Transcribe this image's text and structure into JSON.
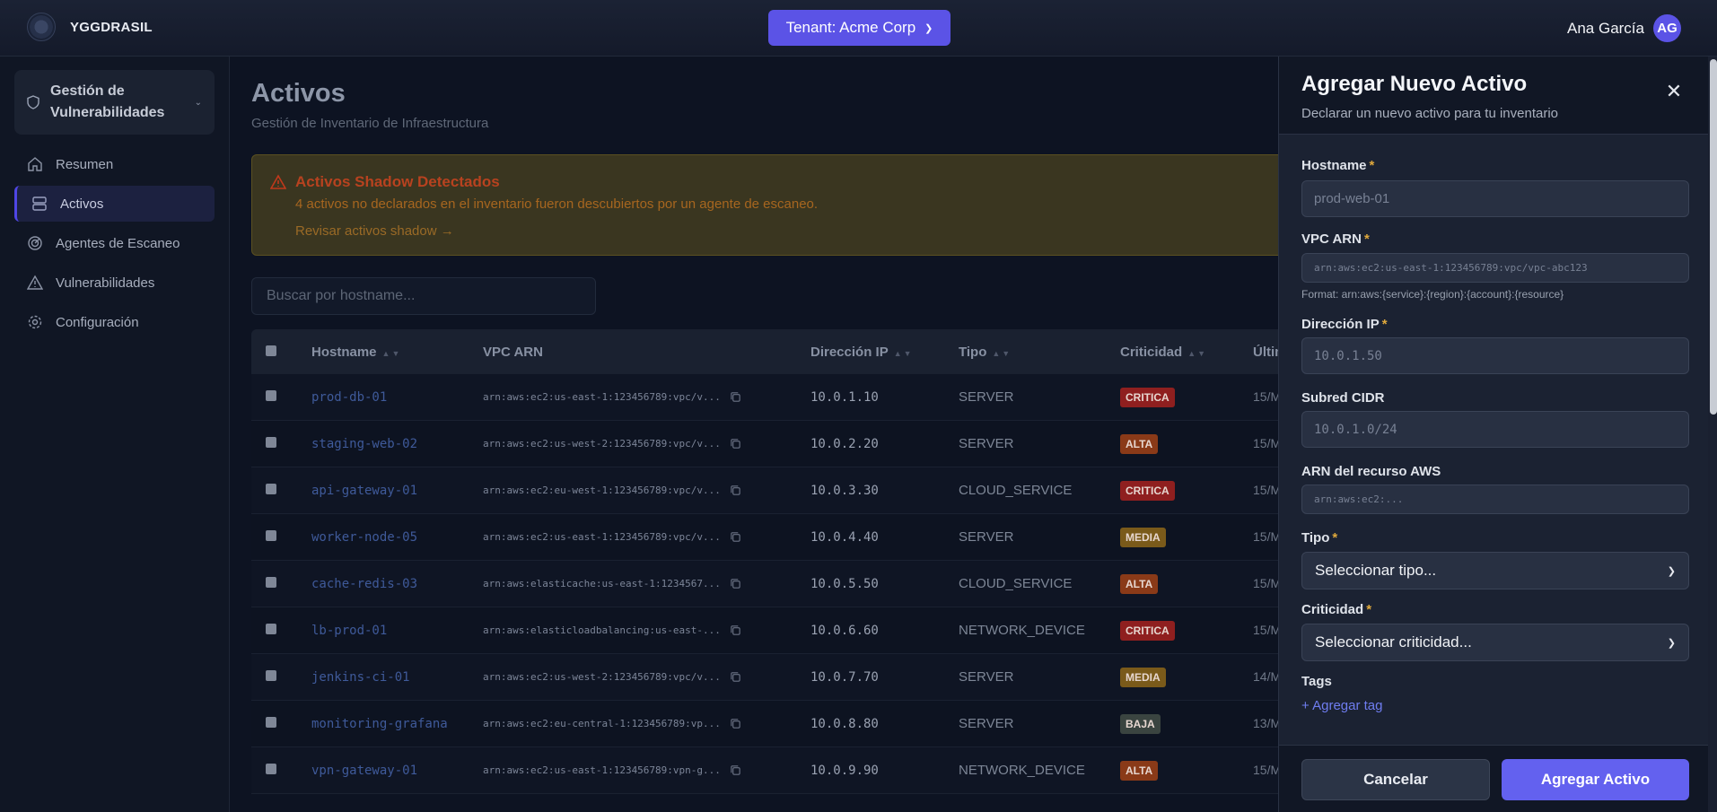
{
  "app": {
    "name": "YGGDRASIL"
  },
  "tenant": {
    "label": "Tenant: Acme Corp"
  },
  "user": {
    "name": "Ana García",
    "initials": "AG"
  },
  "sidebar": {
    "module": "Gestión de Vulnerabilidades",
    "items": [
      {
        "label": "Resumen",
        "icon": "home-icon"
      },
      {
        "label": "Activos",
        "icon": "server-icon",
        "active": true
      },
      {
        "label": "Agentes de Escaneo",
        "icon": "radar-icon"
      },
      {
        "label": "Vulnerabilidades",
        "icon": "warning-icon"
      },
      {
        "label": "Configuración",
        "icon": "gear-icon"
      }
    ]
  },
  "page": {
    "title": "Activos",
    "subtitle": "Gestión de Inventario de Infraestructura"
  },
  "alert": {
    "title": "Activos Shadow Detectados",
    "message": "4 activos no declarados en el inventario fueron descubiertos por un agente de escaneo.",
    "link": "Revisar activos shadow →"
  },
  "search": {
    "placeholder": "Buscar por hostname..."
  },
  "table": {
    "headers": {
      "hostname": "Hostname",
      "vpc": "VPC ARN",
      "ip": "Dirección IP",
      "tipo": "Tipo",
      "criticidad": "Criticidad",
      "ultimo": "Últim"
    },
    "rows": [
      {
        "hostname": "prod-db-01",
        "vpc": "arn:aws:ec2:us-east-1:123456789:vpc/v...",
        "ip": "10.0.1.10",
        "tipo": "SERVER",
        "criticidad": "CRITICA",
        "ultimo": "15/M"
      },
      {
        "hostname": "staging-web-02",
        "vpc": "arn:aws:ec2:us-west-2:123456789:vpc/v...",
        "ip": "10.0.2.20",
        "tipo": "SERVER",
        "criticidad": "ALTA",
        "ultimo": "15/M"
      },
      {
        "hostname": "api-gateway-01",
        "vpc": "arn:aws:ec2:eu-west-1:123456789:vpc/v...",
        "ip": "10.0.3.30",
        "tipo": "CLOUD_SERVICE",
        "criticidad": "CRITICA",
        "ultimo": "15/M"
      },
      {
        "hostname": "worker-node-05",
        "vpc": "arn:aws:ec2:us-east-1:123456789:vpc/v...",
        "ip": "10.0.4.40",
        "tipo": "SERVER",
        "criticidad": "MEDIA",
        "ultimo": "15/M"
      },
      {
        "hostname": "cache-redis-03",
        "vpc": "arn:aws:elasticache:us-east-1:1234567...",
        "ip": "10.0.5.50",
        "tipo": "CLOUD_SERVICE",
        "criticidad": "ALTA",
        "ultimo": "15/M"
      },
      {
        "hostname": "lb-prod-01",
        "vpc": "arn:aws:elasticloadbalancing:us-east-...",
        "ip": "10.0.6.60",
        "tipo": "NETWORK_DEVICE",
        "criticidad": "CRITICA",
        "ultimo": "15/M"
      },
      {
        "hostname": "jenkins-ci-01",
        "vpc": "arn:aws:ec2:us-west-2:123456789:vpc/v...",
        "ip": "10.0.7.70",
        "tipo": "SERVER",
        "criticidad": "MEDIA",
        "ultimo": "14/M"
      },
      {
        "hostname": "monitoring-grafana",
        "vpc": "arn:aws:ec2:eu-central-1:123456789:vp...",
        "ip": "10.0.8.80",
        "tipo": "SERVER",
        "criticidad": "BAJA",
        "ultimo": "13/M"
      },
      {
        "hostname": "vpn-gateway-01",
        "vpc": "arn:aws:ec2:us-east-1:123456789:vpn-g...",
        "ip": "10.0.9.90",
        "tipo": "NETWORK_DEVICE",
        "criticidad": "ALTA",
        "ultimo": "15/M"
      }
    ]
  },
  "badge_colors": {
    "CRITICA": "#8f1f1f",
    "ALTA": "#8a3a18",
    "MEDIA": "#7a5a1a",
    "BAJA": "#3a4440"
  },
  "panel": {
    "title": "Agregar Nuevo Activo",
    "subtitle": "Declarar un nuevo activo para tu inventario",
    "fields": {
      "hostname": {
        "label": "Hostname",
        "placeholder": "prod-web-01"
      },
      "vpc": {
        "label": "VPC ARN",
        "placeholder": "arn:aws:ec2:us-east-1:123456789:vpc/vpc-abc123",
        "hint": "Format: arn:aws:{service}:{region}:{account}:{resource}"
      },
      "ip": {
        "label": "Dirección IP",
        "placeholder": "10.0.1.50"
      },
      "cidr": {
        "label": "Subred CIDR",
        "placeholder": "10.0.1.0/24"
      },
      "resource_arn": {
        "label": "ARN del recurso AWS",
        "placeholder": "arn:aws:ec2:..."
      },
      "tipo": {
        "label": "Tipo",
        "value": "Seleccionar tipo..."
      },
      "criticidad": {
        "label": "Criticidad",
        "value": "Seleccionar criticidad..."
      },
      "tags": {
        "label": "Tags",
        "add": "+ Agregar tag"
      }
    },
    "cancel": "Cancelar",
    "submit": "Agregar Activo"
  }
}
